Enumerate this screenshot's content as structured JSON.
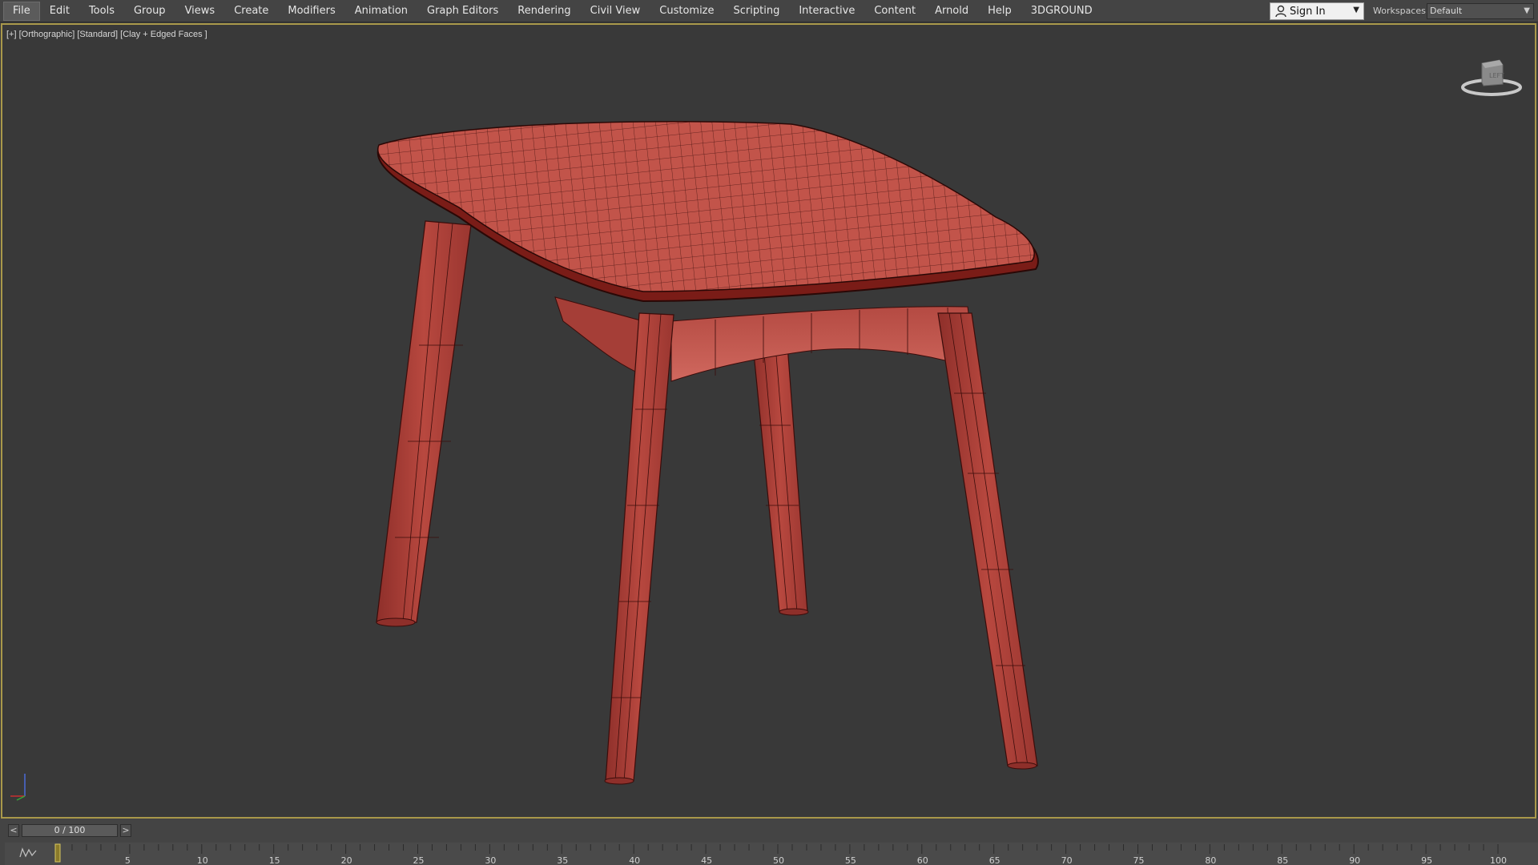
{
  "menubar": {
    "items": [
      "File",
      "Edit",
      "Tools",
      "Group",
      "Views",
      "Create",
      "Modifiers",
      "Animation",
      "Graph Editors",
      "Rendering",
      "Civil View",
      "Customize",
      "Scripting",
      "Interactive",
      "Content",
      "Arnold",
      "Help",
      "3DGROUND"
    ],
    "signin_label": "Sign In",
    "workspaces_label": "Workspaces:",
    "workspace_value": "Default"
  },
  "viewport": {
    "label": "[+] [Orthographic] [Standard] [Clay + Edged Faces ]",
    "model_name": "table",
    "model_color": "#b5463f",
    "wire_color": "#3a0c0a",
    "border_color": "#a9984a"
  },
  "timeline": {
    "prev_label": "<",
    "next_label": ">",
    "frame_display": "0 / 100",
    "current_frame": 0,
    "range": [
      0,
      100
    ],
    "major_ticks": [
      0,
      5,
      10,
      15,
      20,
      25,
      30,
      35,
      40,
      45,
      50,
      55,
      60,
      65,
      70,
      75,
      80,
      85,
      90,
      95,
      100
    ],
    "curve_icon": "curve-editor-icon"
  }
}
